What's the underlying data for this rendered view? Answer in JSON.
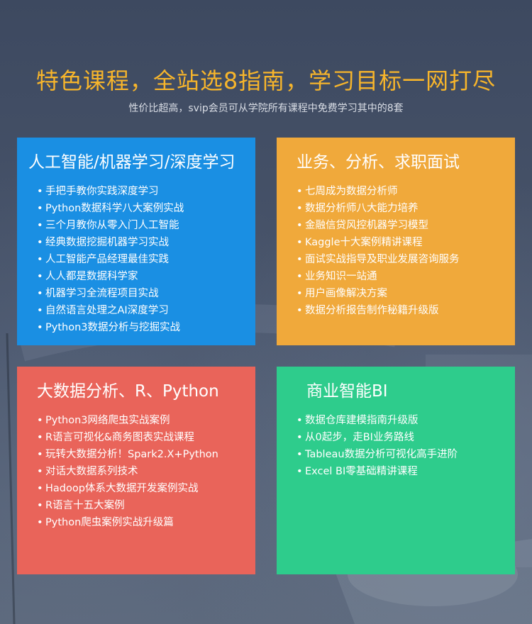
{
  "header": {
    "title": "特色课程，全站选8指南，学习目标一网打尽",
    "subtitle": "性价比超高，svip会员可从学院所有课程中免费学习其中的8套"
  },
  "colors": {
    "title": "#f7b52b",
    "ai_card": "#1a8fe3",
    "business_card": "#f0a93b",
    "bigdata_card": "#e9645a",
    "bi_card": "#2ecc8c"
  },
  "bullet": "•",
  "cards": {
    "ai": {
      "title": "人工智能/机器学习/深度学习",
      "items": [
        "手把手教你实践深度学习",
        "Python数据科学八大案例实战",
        "三个月教你从零入门人工智能",
        "经典数据挖掘机器学习实战",
        "人工智能产品经理最佳实践",
        "人人都是数据科学家",
        "机器学习全流程项目实战",
        "自然语言处理之AI深度学习",
        "Python3数据分析与挖掘实战"
      ]
    },
    "business": {
      "title": "业务、分析、求职面试",
      "items": [
        "七周成为数据分析师",
        "数据分析师八大能力培养",
        "金融信贷风控机器学习模型",
        "Kaggle十大案例精讲课程",
        "面试实战指导及职业发展咨询服务",
        "业务知识一站通",
        "用户画像解决方案",
        "数据分析报告制作秘籍升级版"
      ]
    },
    "bigdata": {
      "title": "大数据分析、R、Python",
      "items": [
        "Python3网络爬虫实战案例",
        "R语言可视化&商务图表实战课程",
        "玩转大数据分析！Spark2.X+Python",
        "对话大数据系列技术",
        "Hadoop体系大数据开发案例实战",
        "R语言十五大案例",
        "Python爬虫案例实战升级篇"
      ]
    },
    "bi": {
      "title": "商业智能BI",
      "items": [
        "数据仓库建模指南升级版",
        "从0起步，走BI业务路线",
        "Tableau数据分析可视化高手进阶",
        "Excel BI零基础精讲课程"
      ]
    }
  }
}
